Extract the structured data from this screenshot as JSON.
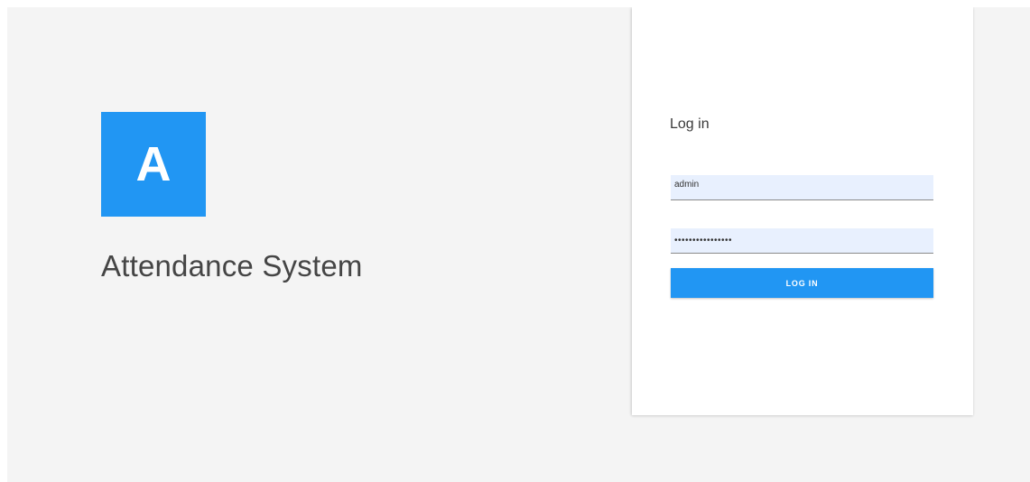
{
  "brand": {
    "logo_letter": "A",
    "app_name": "Attendance System",
    "accent_color": "#2196f3"
  },
  "login": {
    "title": "Log in",
    "username_value": "admin",
    "password_value": "••••••••••••••••",
    "submit_label": "LOG IN"
  }
}
